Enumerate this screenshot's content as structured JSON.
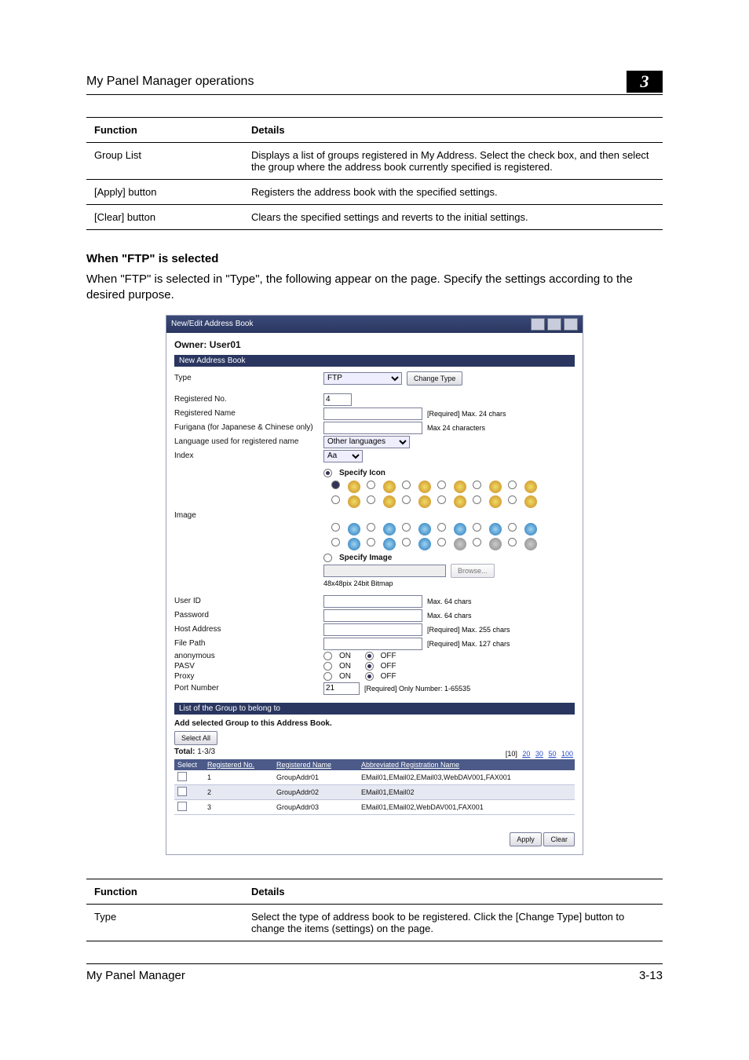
{
  "header": {
    "title": "My Panel Manager operations",
    "chapter": "3"
  },
  "table1": {
    "headers": {
      "function": "Function",
      "details": "Details"
    },
    "rows": [
      {
        "func": "Group List",
        "details": "Displays a list of groups registered in My Address. Select the check box, and then select the group where the address book currently specified is registered."
      },
      {
        "func": "[Apply] button",
        "details": "Registers the address book with the specified settings."
      },
      {
        "func": "[Clear] button",
        "details": "Clears the specified settings and reverts to the initial settings."
      }
    ]
  },
  "section": {
    "heading": "When \"FTP\" is selected",
    "paragraph": "When \"FTP\" is selected in \"Type\", the following appear on the page. Specify the settings according to the desired purpose."
  },
  "screenshot": {
    "titlebar": "New/Edit Address Book",
    "owner_label": "Owner:",
    "owner_value": "User01",
    "sub1": "New Address Book",
    "type_label": "Type",
    "type_value": "FTP",
    "change_type": "Change Type",
    "regno_label": "Registered No.",
    "regno_value": "4",
    "regname_label": "Registered Name",
    "regname_note": "[Required] Max. 24 chars",
    "furigana_label": "Furigana (for Japanese & Chinese only)",
    "furigana_note": "Max 24 characters",
    "lang_label": "Language used for registered name",
    "lang_value": "Other languages",
    "index_label": "Index",
    "index_value": "Aa",
    "specify_icon": "Specify Icon",
    "image_label": "Image",
    "specify_image": "Specify Image",
    "browse_btn": "Browse...",
    "bitmap_note": "48x48pix 24bit Bitmap",
    "userid_label": "User ID",
    "userid_note": "Max. 64 chars",
    "password_label": "Password",
    "password_note": "Max. 64 chars",
    "host_label": "Host Address",
    "host_note": "[Required] Max. 255 chars",
    "filepath_label": "File Path",
    "filepath_note": "[Required] Max. 127 chars",
    "anon_label": "anonymous",
    "pasv_label": "PASV",
    "proxy_label": "Proxy",
    "on_label": "ON",
    "off_label": "OFF",
    "port_label": "Port Number",
    "port_value": "21",
    "port_note": "[Required] Only Number: 1-65535",
    "sub2": "List of the Group to belong to",
    "add_line": "Add selected Group to this Address Book.",
    "select_all": "Select All",
    "total_label": "Total:",
    "total_range": "1-3/3",
    "pager": {
      "p10": "[10]",
      "p20": "20",
      "p30": "30",
      "p50": "50",
      "p100": "100"
    },
    "gt_headers": {
      "sel": "Select",
      "regno": "Registered No.",
      "regname": "Registered Name",
      "abbr": "Abbreviated Registration Name"
    },
    "gt_rows": [
      {
        "no": "1",
        "name": "GroupAddr01",
        "abbr": "EMail01,EMail02,EMail03,WebDAV001,FAX001"
      },
      {
        "no": "2",
        "name": "GroupAddr02",
        "abbr": "EMail01,EMail02"
      },
      {
        "no": "3",
        "name": "GroupAddr03",
        "abbr": "EMail01,EMail02,WebDAV001,FAX001"
      }
    ],
    "apply": "Apply",
    "clear": "Clear"
  },
  "table2": {
    "headers": {
      "function": "Function",
      "details": "Details"
    },
    "rows": [
      {
        "func": "Type",
        "details": "Select the type of address book to be registered. Click the [Change Type] button to change the items (settings) on the page."
      }
    ]
  },
  "footer": {
    "left": "My Panel Manager",
    "right": "3-13"
  }
}
